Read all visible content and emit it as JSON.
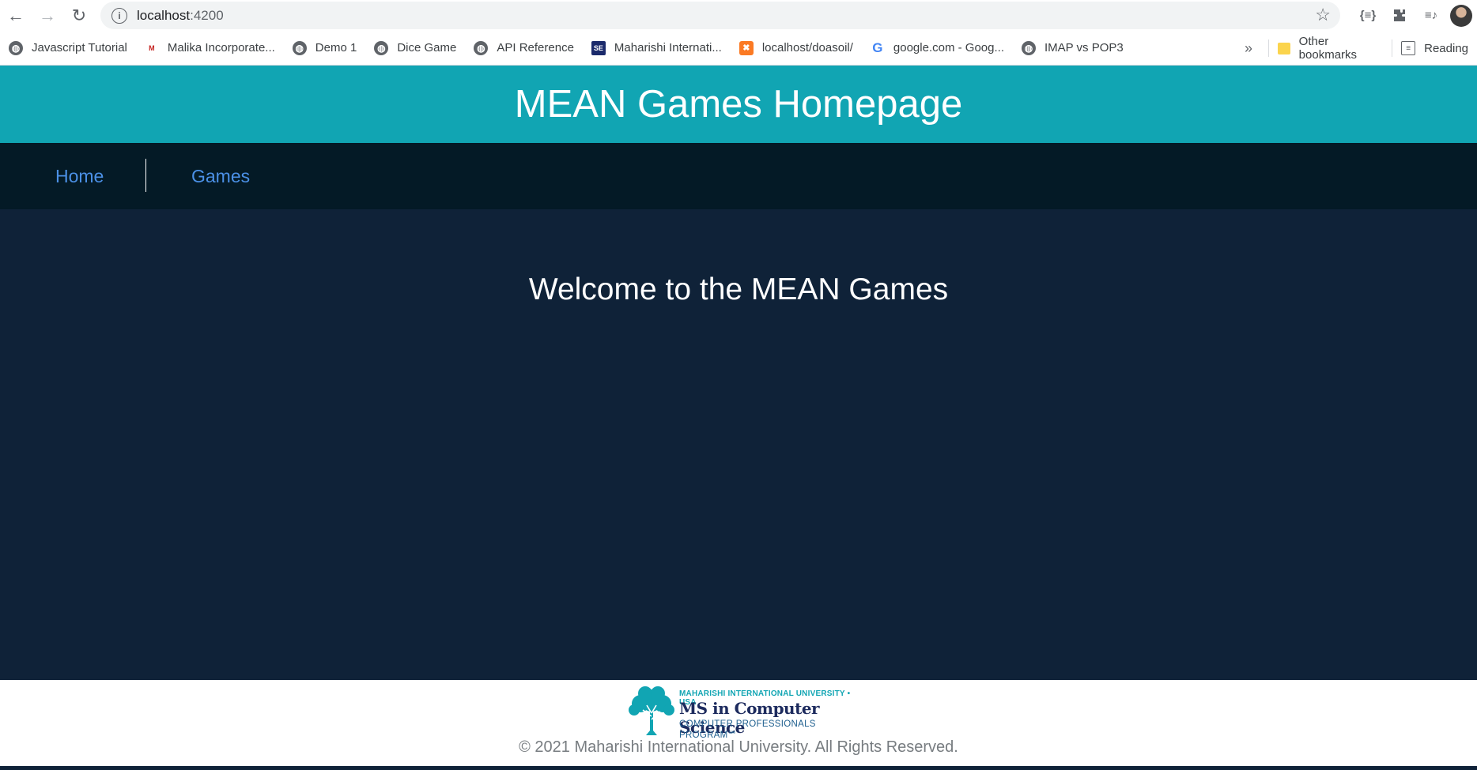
{
  "browser": {
    "url_host": "localhost",
    "url_port": ":4200",
    "bookmarks": [
      {
        "label": "Javascript Tutorial",
        "icon": "globe-icon"
      },
      {
        "label": "Malika Incorporate...",
        "icon": "gmail-icon"
      },
      {
        "label": "Demo 1",
        "icon": "globe-icon"
      },
      {
        "label": "Dice Game",
        "icon": "globe-icon"
      },
      {
        "label": "API Reference",
        "icon": "globe-icon"
      },
      {
        "label": "Maharishi Internati...",
        "icon": "se-icon"
      },
      {
        "label": "localhost/doasoil/",
        "icon": "xampp-icon"
      },
      {
        "label": "google.com - Goog...",
        "icon": "google-icon"
      },
      {
        "label": "IMAP vs POP3",
        "icon": "globe-icon"
      }
    ],
    "more_bookmarks": "»",
    "other_bookmarks": "Other bookmarks",
    "reading_list": "Reading"
  },
  "page": {
    "banner_title": "MEAN Games Homepage",
    "nav": {
      "home": "Home",
      "games": "Games"
    },
    "welcome": "Welcome to the MEAN Games",
    "footer": {
      "logo_line1": "MAHARISHI INTERNATIONAL UNIVERSITY • USA",
      "logo_line2": "MS in Computer Science",
      "logo_line3": "COMPUTER PROFESSIONALS PROGRAM℠",
      "copyright": "© 2021 Maharishi International University. All Rights Reserved."
    }
  },
  "colors": {
    "banner": "#11a5b3",
    "navbar": "#041a26",
    "page_bg": "#0f2238",
    "nav_link": "#4b90e6"
  }
}
